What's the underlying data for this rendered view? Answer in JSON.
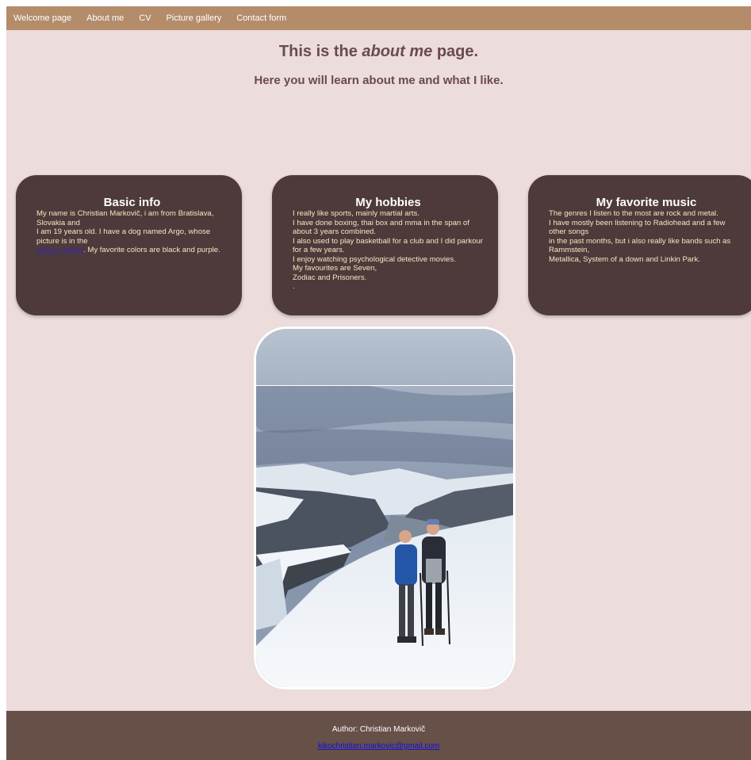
{
  "nav": {
    "items": [
      {
        "label": "Welcome page"
      },
      {
        "label": "About me"
      },
      {
        "label": "CV"
      },
      {
        "label": "Picture gallery"
      },
      {
        "label": "Contact form"
      }
    ]
  },
  "header": {
    "title_pre": "This is the ",
    "title_em": "about me",
    "title_post": " page.",
    "subtitle": "Here you will learn about me and what I like."
  },
  "cards": {
    "basic": {
      "heading": "Basic info",
      "line1": "My name is Christian Markovič, i am from Bratislava, Slovakia and",
      "line2": "I am 19 years old. I have a dog named Argo, whose picture is in the",
      "link": "picture gallery",
      "line3": ". My favorite colors are black and purple."
    },
    "hobbies": {
      "heading": "My hobbies",
      "line1": "I really like sports, mainly martial arts.",
      "line2": "I have done boxing, thai box and mma in the span of about 3 years combined.",
      "line3": "I also used to play basketball for a club and I did parkour for a few years.",
      "line4": "I enjoy watching psychological detective movies.",
      "line5": "My favourites are Seven,",
      "line6": "Zodiac and Prisoners.",
      "line7": "."
    },
    "music": {
      "heading": "My favorite music",
      "line1": "The genres I listen to the most are rock and metal.",
      "line2": "I have mostly been listening to Radiohead and a few other songs",
      "line3": "in the past months, but i also really like bands such as Rammstein,",
      "line4": "Metallica, System of a down and Linkin Park."
    }
  },
  "footer": {
    "author": "Author: Christian Markovič",
    "email": "kikochristian.markovic@gmail.com"
  }
}
